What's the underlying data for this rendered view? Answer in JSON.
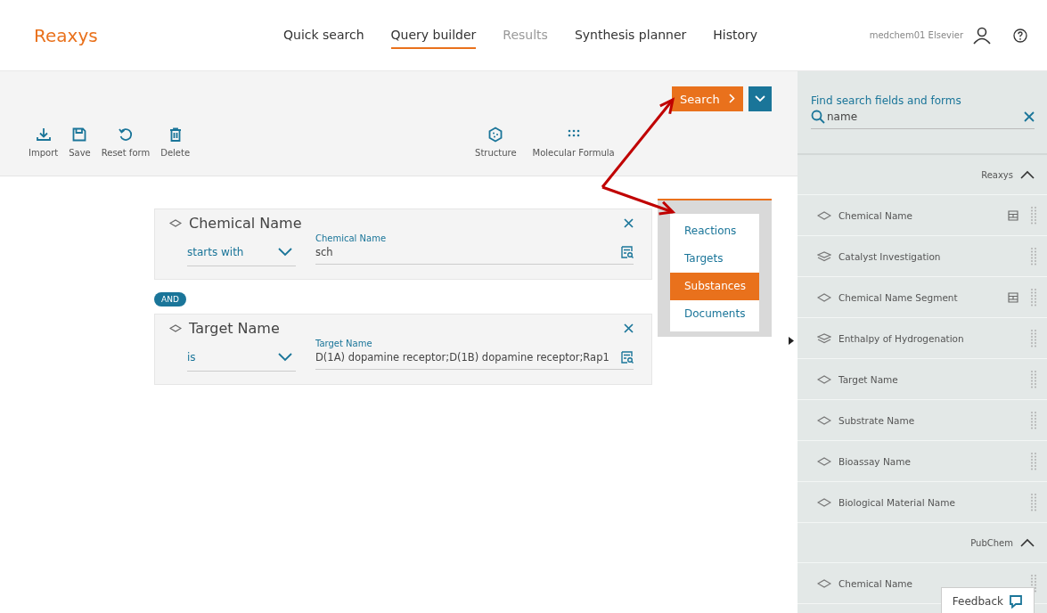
{
  "header": {
    "logo": "Reaxys",
    "nav": [
      {
        "label": "Quick search",
        "selected": false,
        "disabled": false
      },
      {
        "label": "Query builder",
        "selected": true,
        "disabled": false
      },
      {
        "label": "Results",
        "selected": false,
        "disabled": true
      },
      {
        "label": "Synthesis planner",
        "selected": false,
        "disabled": false
      },
      {
        "label": "History",
        "selected": false,
        "disabled": false
      }
    ],
    "user": "medchem01 Elsevier"
  },
  "toolbar": {
    "left": [
      {
        "label": "Import"
      },
      {
        "label": "Save"
      },
      {
        "label": "Reset form"
      },
      {
        "label": "Delete"
      }
    ],
    "right": [
      {
        "label": "Structure"
      },
      {
        "label": "Molecular Formula"
      }
    ],
    "search_button": "Search",
    "search_menu": [
      {
        "label": "Reactions",
        "selected": false
      },
      {
        "label": "Targets",
        "selected": false
      },
      {
        "label": "Substances",
        "selected": true
      },
      {
        "label": "Documents",
        "selected": false
      }
    ]
  },
  "query": {
    "rows": [
      {
        "title": "Chemical Name",
        "operator": "starts with",
        "field_label": "Chemical Name",
        "value": "sch"
      },
      {
        "title": "Target Name",
        "operator": "is",
        "field_label": "Target Name",
        "value": "D(1A) dopamine receptor;D(1B) dopamine receptor;Rap1"
      }
    ],
    "connectors": [
      "AND"
    ]
  },
  "panel": {
    "search_label": "Find search fields and forms",
    "search_value": "name",
    "sections": [
      {
        "title": "Reaxys",
        "expanded": true,
        "items": [
          {
            "label": "Chemical Name",
            "kind": "field",
            "has_form": true
          },
          {
            "label": "Catalyst Investigation",
            "kind": "group",
            "has_form": false
          },
          {
            "label": "Chemical Name Segment",
            "kind": "field",
            "has_form": true
          },
          {
            "label": "Enthalpy of Hydrogenation",
            "kind": "group",
            "has_form": false
          },
          {
            "label": "Target Name",
            "kind": "field",
            "has_form": false
          },
          {
            "label": "Substrate Name",
            "kind": "field",
            "has_form": false
          },
          {
            "label": "Bioassay Name",
            "kind": "field",
            "has_form": false
          },
          {
            "label": "Biological Material Name",
            "kind": "field",
            "has_form": false
          }
        ]
      },
      {
        "title": "PubChem",
        "expanded": true,
        "items": [
          {
            "label": "Chemical Name",
            "kind": "field",
            "has_form": false
          }
        ]
      }
    ]
  },
  "feedback": "Feedback"
}
